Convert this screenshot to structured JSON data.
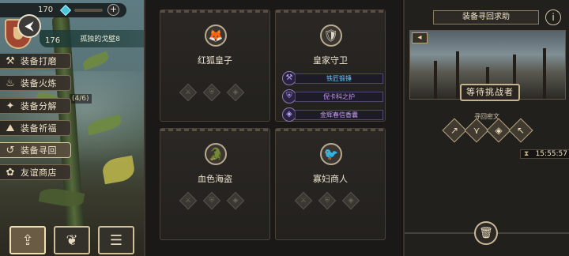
{
  "top_bar": {
    "resource_value": "170",
    "add_label": "+"
  },
  "profile": {
    "emblem_arrow": "⮜",
    "level": "176",
    "guild_name": "孤独的戈壁8"
  },
  "sidebar": {
    "items": [
      {
        "label": "装备打磨",
        "icon": "hammer-icon",
        "glyph": "⚒"
      },
      {
        "label": "装备火炼",
        "icon": "flame-icon",
        "glyph": "♨"
      },
      {
        "label": "装备分解",
        "icon": "decompose-icon",
        "glyph": "✦"
      },
      {
        "label": "装备祈福",
        "icon": "bless-icon",
        "glyph": "⛰"
      },
      {
        "label": "装备寻回",
        "icon": "retrieve-icon",
        "glyph": "↺"
      },
      {
        "label": "友谊商店",
        "icon": "fox-icon",
        "glyph": "✿"
      }
    ],
    "decompose_progress": "(4/6)",
    "active_index": 4
  },
  "bottom_buttons": [
    {
      "name": "upload-button",
      "glyph": "⇪"
    },
    {
      "name": "leaf-button",
      "glyph": "❦"
    },
    {
      "name": "list-button",
      "glyph": "☰"
    }
  ],
  "cards": [
    {
      "name": "红狐皇子",
      "portrait_glyph": "🦊",
      "slots": [
        "⚔",
        "⛨",
        "◈"
      ]
    },
    {
      "name": "皇家守卫",
      "portrait_glyph": "🛡",
      "equipment": [
        {
          "label": "铁匠锻锤",
          "tier": "blue",
          "glyph": "⚒"
        },
        {
          "label": "倪卡科之护",
          "tier": "purple",
          "glyph": "⛨"
        },
        {
          "label": "金辉春信香囊",
          "tier": "purple",
          "glyph": "◈"
        }
      ]
    },
    {
      "name": "血色海盗",
      "portrait_glyph": "🐊",
      "slots": [
        "⚔",
        "⛨",
        "◈"
      ]
    },
    {
      "name": "寡妇商人",
      "portrait_glyph": "🐦",
      "slots": [
        "⚔",
        "⛨",
        "◈"
      ]
    }
  ],
  "right_panel": {
    "title": "装备寻回求助",
    "info_glyph": "i",
    "corner_glyph": "◂",
    "status_banner": "等待挑战者",
    "cipher_label": "寻回密文",
    "cipher_symbols": [
      "↗",
      "⋎",
      "◈",
      "↖"
    ],
    "timer": "15:55:57",
    "trash_glyph": "🗑"
  }
}
